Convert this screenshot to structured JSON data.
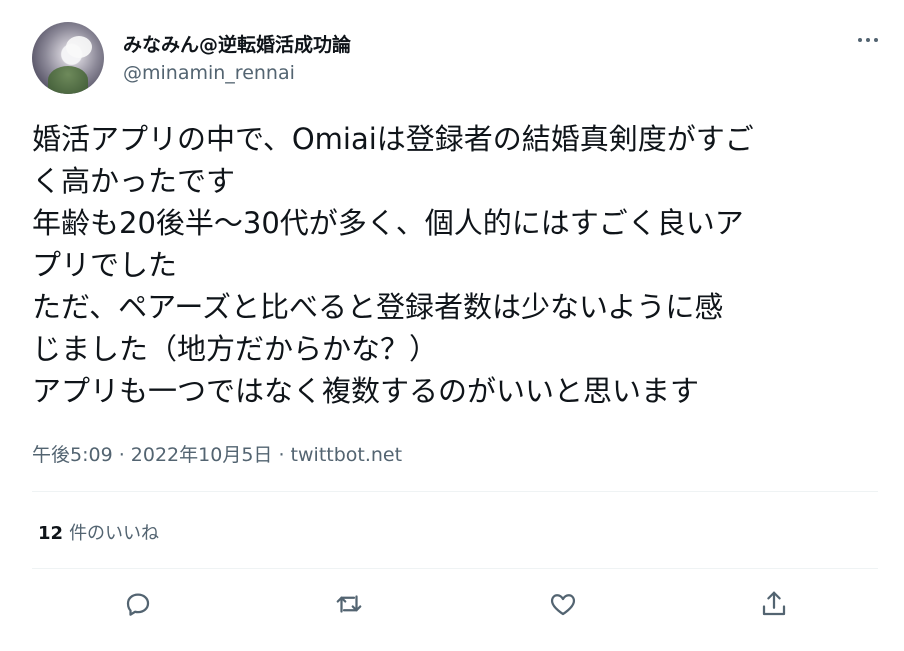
{
  "author": {
    "display_name": "みなみん@逆転婚活成功論",
    "handle": "@minamin_rennai"
  },
  "tweet": {
    "lines": [
      "婚活アプリの中で、Omiaiは登録者の結婚真剣度がすご",
      "く高かったです",
      "年齢も20後半〜30代が多く、個人的にはすごく良いア",
      "プリでした",
      "ただ、ペアーズと比べると登録者数は少ないように感",
      "じました（地方だからかな？）",
      "アプリも一つではなく複数するのがいいと思います"
    ],
    "time": "午後5:09",
    "date": "2022年10月5日",
    "source": "twittbot.net",
    "separator": " · "
  },
  "stats": {
    "like_count": "12",
    "like_label": "件のいいね"
  },
  "icons": {
    "more": "more-horizontal-icon",
    "reply": "reply-icon",
    "retweet": "retweet-icon",
    "like": "heart-icon",
    "share": "share-icon"
  }
}
